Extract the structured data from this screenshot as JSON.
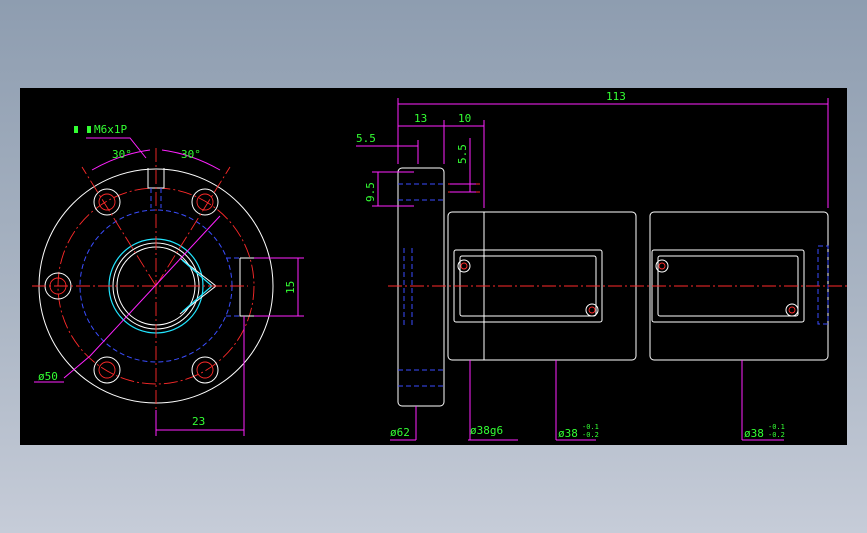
{
  "colors": {
    "background": "#000000",
    "outline": "#ffffff",
    "hidden": "#3a4dff",
    "center": "#ff2a2a",
    "dimension": "#ff22ff",
    "text": "#33ff33"
  },
  "front_view": {
    "hole_note": "M6x1P",
    "angle_left": "30°",
    "angle_right": "30°",
    "dim_15": "15",
    "dim_23": "23",
    "dia_50": "ø50"
  },
  "side_view": {
    "dim_113": "113",
    "dim_13": "13",
    "dim_10": "10",
    "dim_5_5_h": "5.5",
    "dim_5_5_v": "5.5",
    "dim_9_5": "9.5",
    "dia_62": "ø62",
    "dia_38g6": "ø38g6",
    "dia_38_a": "ø38",
    "dia_38_b": "ø38",
    "tol_upper": "-0.1",
    "tol_lower": "-0.2"
  }
}
